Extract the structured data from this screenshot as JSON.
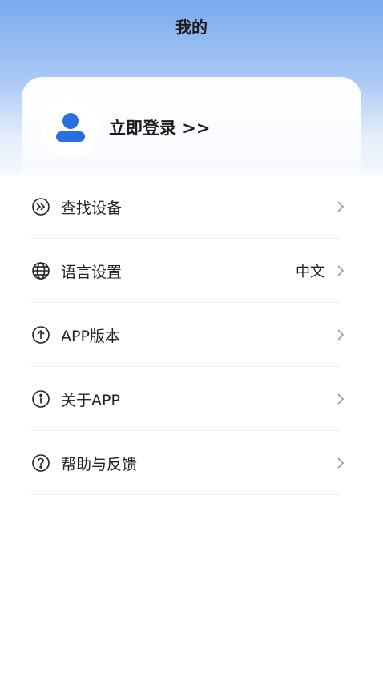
{
  "header": {
    "title": "我的"
  },
  "profile": {
    "login_label": "立即登录 >>",
    "avatar_icon": "user-icon",
    "accent": "#2a6fe0"
  },
  "menu": [
    {
      "label": "查找设备",
      "icon": "find-device-icon",
      "value": ""
    },
    {
      "label": "语言设置",
      "icon": "globe-icon",
      "value": "中文"
    },
    {
      "label": "APP版本",
      "icon": "arrow-up-circle-icon",
      "value": ""
    },
    {
      "label": "关于APP",
      "icon": "info-circle-icon",
      "value": ""
    },
    {
      "label": "帮助与反馈",
      "icon": "help-circle-icon",
      "value": ""
    }
  ]
}
